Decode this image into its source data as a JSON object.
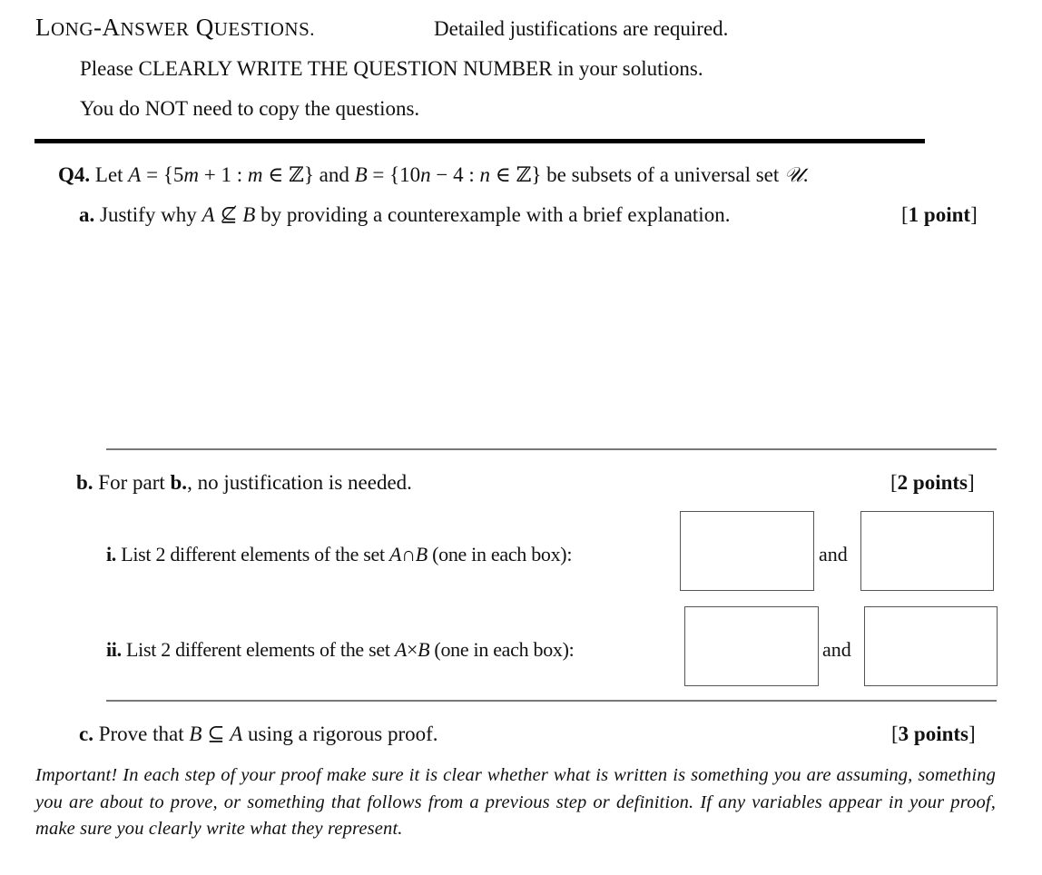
{
  "header": {
    "title_L": "L",
    "title_ong": "ONG",
    "title_dash_A": "-A",
    "title_nswer": "NSWER",
    "title_Q": " Q",
    "title_uestions": "UESTIONS.",
    "subtitle": "Detailed justifications are required.",
    "line1": "Please CLEARLY WRITE THE QUESTION NUMBER in your solutions.",
    "line2": "You do NOT need to copy the questions."
  },
  "question": {
    "number": "Q4.",
    "stmt_let": "Let ",
    "A": "A",
    "eq1": " = {5",
    "m1": "m",
    "plus1": " + 1 : ",
    "m2": "m",
    "in1": " ∈ ℤ} and ",
    "B": "B",
    "eq2": " = {10",
    "n1": "n",
    "minus4": " − 4 : ",
    "n2": "n",
    "in2": " ∈ ℤ} be subsets of a universal set ",
    "U": "𝒰",
    "period": "."
  },
  "part_a": {
    "label": "a.",
    "text_pre": "Justify why ",
    "A": "A",
    "notsubset": " ⊈ ",
    "B": "B",
    "text_post": " by providing a counterexample with a brief explanation.",
    "points_open": "[",
    "points": "1 point",
    "points_close": "]"
  },
  "part_b": {
    "label": "b.",
    "text_pre": "For part ",
    "bold_b": "b.",
    "text_post": ", no justification is needed.",
    "points_open": "[",
    "points": "2 points",
    "points_close": "]",
    "sub_i": {
      "label": "i.",
      "text_pre": "List 2 different elements of the set ",
      "A": "A",
      "op": "∩",
      "B": "B",
      "text_post": " (one in each box):",
      "and": "and",
      "box1_value": "",
      "box2_value": ""
    },
    "sub_ii": {
      "label": "ii.",
      "text_pre": "List 2 different elements of the set ",
      "A": "A",
      "op": "×",
      "B": "B",
      "text_post": " (one in each box):",
      "and": "and",
      "box1_value": "",
      "box2_value": ""
    }
  },
  "part_c": {
    "label": "c.",
    "text_pre": "Prove that ",
    "B": "B",
    "subset": " ⊆ ",
    "A": "A",
    "text_post": " using a rigorous proof.",
    "points_open": "[",
    "points": "3 points",
    "points_close": "]",
    "note": "Important! In each step of your proof make sure it is clear whether what is written is something you are assuming, something you are about to prove, or something that follows from a previous step or definition. If any variables appear in your proof, make sure you clearly write what they represent."
  }
}
